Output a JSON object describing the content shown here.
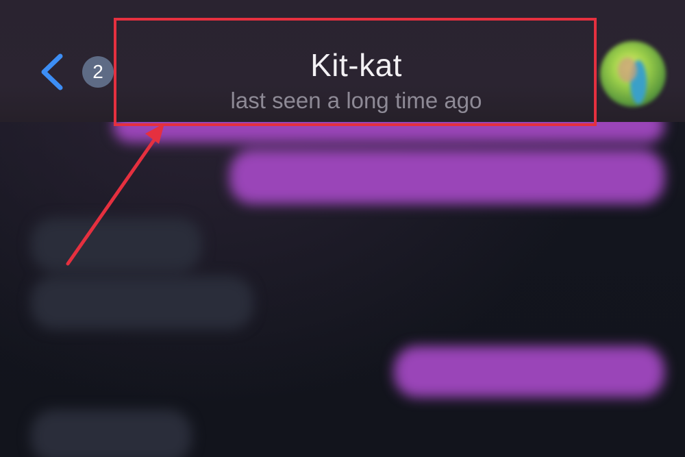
{
  "header": {
    "unread_count": "2",
    "contact_name": "Kit-kat",
    "status": "last seen a long time ago"
  },
  "colors": {
    "accent": "#3d8ef5",
    "annotation": "#e5303f",
    "outgoing_bubble": "#9a45b8",
    "incoming_bubble": "#2a2d3a"
  },
  "icons": {
    "back": "chevron-left-icon",
    "avatar": "contact-avatar"
  }
}
